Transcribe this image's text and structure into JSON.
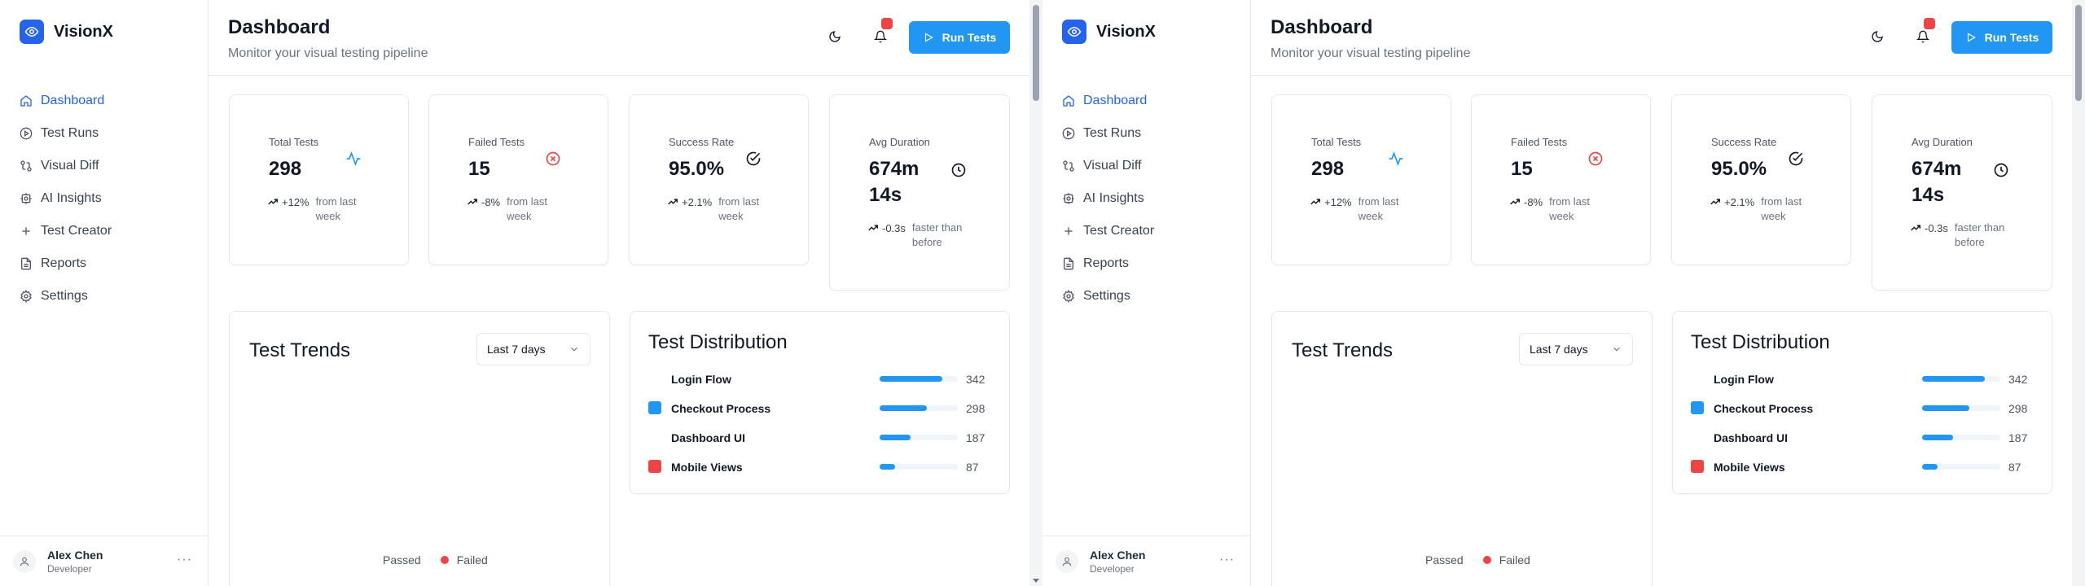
{
  "app": {
    "name": "VisionX"
  },
  "sidebar": {
    "items": [
      {
        "label": "Dashboard",
        "icon": "home-icon",
        "active": true
      },
      {
        "label": "Test Runs",
        "icon": "play-circle-icon",
        "active": false
      },
      {
        "label": "Visual Diff",
        "icon": "git-compare-icon",
        "active": false
      },
      {
        "label": "AI Insights",
        "icon": "brain-icon",
        "active": false
      },
      {
        "label": "Test Creator",
        "icon": "plus-icon",
        "active": false
      },
      {
        "label": "Reports",
        "icon": "file-icon",
        "active": false
      },
      {
        "label": "Settings",
        "icon": "gear-icon",
        "active": false
      }
    ],
    "user": {
      "name": "Alex Chen",
      "role": "Developer",
      "more": "···"
    }
  },
  "header": {
    "title": "Dashboard",
    "subtitle": "Monitor your visual testing pipeline",
    "run_label": "Run Tests"
  },
  "stats": [
    {
      "label": "Total Tests",
      "value": "298",
      "change": "+12%",
      "note": "from last week",
      "icon": "activity-icon",
      "icon_color": "#2196f3"
    },
    {
      "label": "Failed Tests",
      "value": "15",
      "change": "-8%",
      "note": "from last week",
      "icon": "x-circle-icon",
      "icon_color": "#ef4444"
    },
    {
      "label": "Success Rate",
      "value": "95.0%",
      "change": "+2.1%",
      "note": "from last week",
      "icon": "check-circle-icon",
      "icon_color": "#111827"
    },
    {
      "label": "Avg Duration",
      "value": "674m 14s",
      "change": "-0.3s",
      "note": "faster than before",
      "icon": "clock-icon",
      "icon_color": "#111827"
    }
  ],
  "trends": {
    "title": "Test Trends",
    "range": "Last 7 days",
    "legend": [
      {
        "label": "Passed",
        "color": "#ffffff"
      },
      {
        "label": "Failed",
        "color": "#ef4444"
      }
    ]
  },
  "distribution": {
    "title": "Test Distribution",
    "max": 342,
    "items": [
      {
        "name": "Login Flow",
        "value": 342,
        "fill": 0.8,
        "color": "#ffffff"
      },
      {
        "name": "Checkout Process",
        "value": 298,
        "fill": 0.6,
        "color": "#2196f3"
      },
      {
        "name": "Dashboard UI",
        "value": 187,
        "fill": 0.4,
        "color": "#ffffff"
      },
      {
        "name": "Mobile Views",
        "value": 87,
        "fill": 0.2,
        "color": "#ef4444"
      }
    ]
  },
  "colors": {
    "accent": "#2196f3",
    "brand": "#2563eb",
    "danger": "#ef4444"
  }
}
